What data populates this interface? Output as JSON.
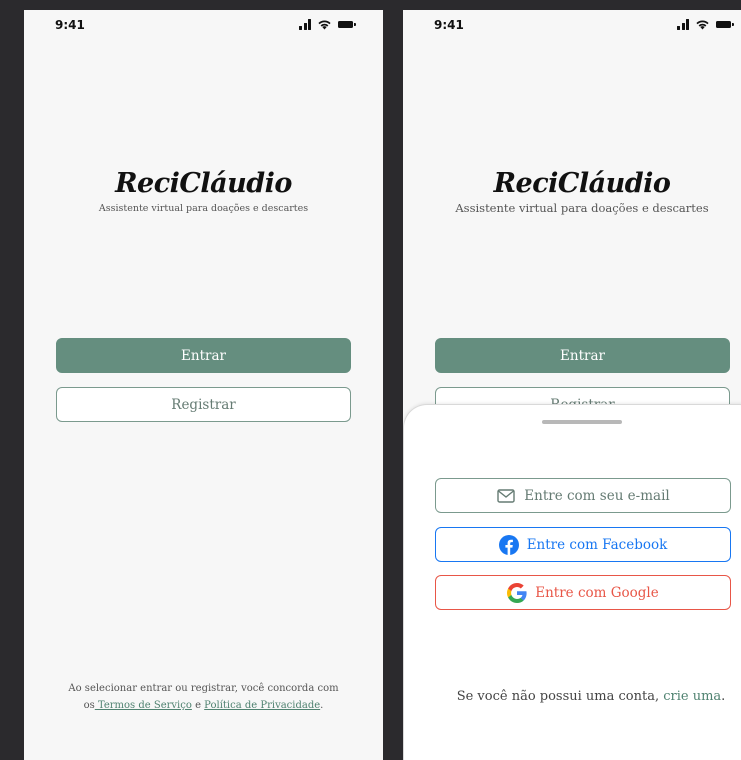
{
  "status_bar": {
    "time": "9:41"
  },
  "brand": {
    "name": "ReciCláudio",
    "tagline": "Assistente virtual para doações e descartes"
  },
  "actions": {
    "login": "Entrar",
    "register": "Registrar"
  },
  "legal": {
    "prefix": "Ao selecionar entrar ou registrar, você concorda com",
    "join_prefix": "os",
    "terms": " Termos de Serviço",
    "join": " e ",
    "privacy": "Política de Privacidade",
    "suffix": "."
  },
  "login_sheet": {
    "email_label": "Entre com seu e-mail",
    "facebook_label": "Entre com Facebook",
    "google_label": "Entre com Google",
    "signup_prompt": "Se você não possui uma conta, ",
    "signup_link": "crie uma",
    "signup_suffix": "."
  },
  "icons": {
    "email": "mail-icon",
    "facebook": "facebook-icon",
    "google": "google-icon"
  },
  "colors": {
    "primary": "#658e7f",
    "facebook": "#1877f2",
    "google": "#e85647"
  }
}
